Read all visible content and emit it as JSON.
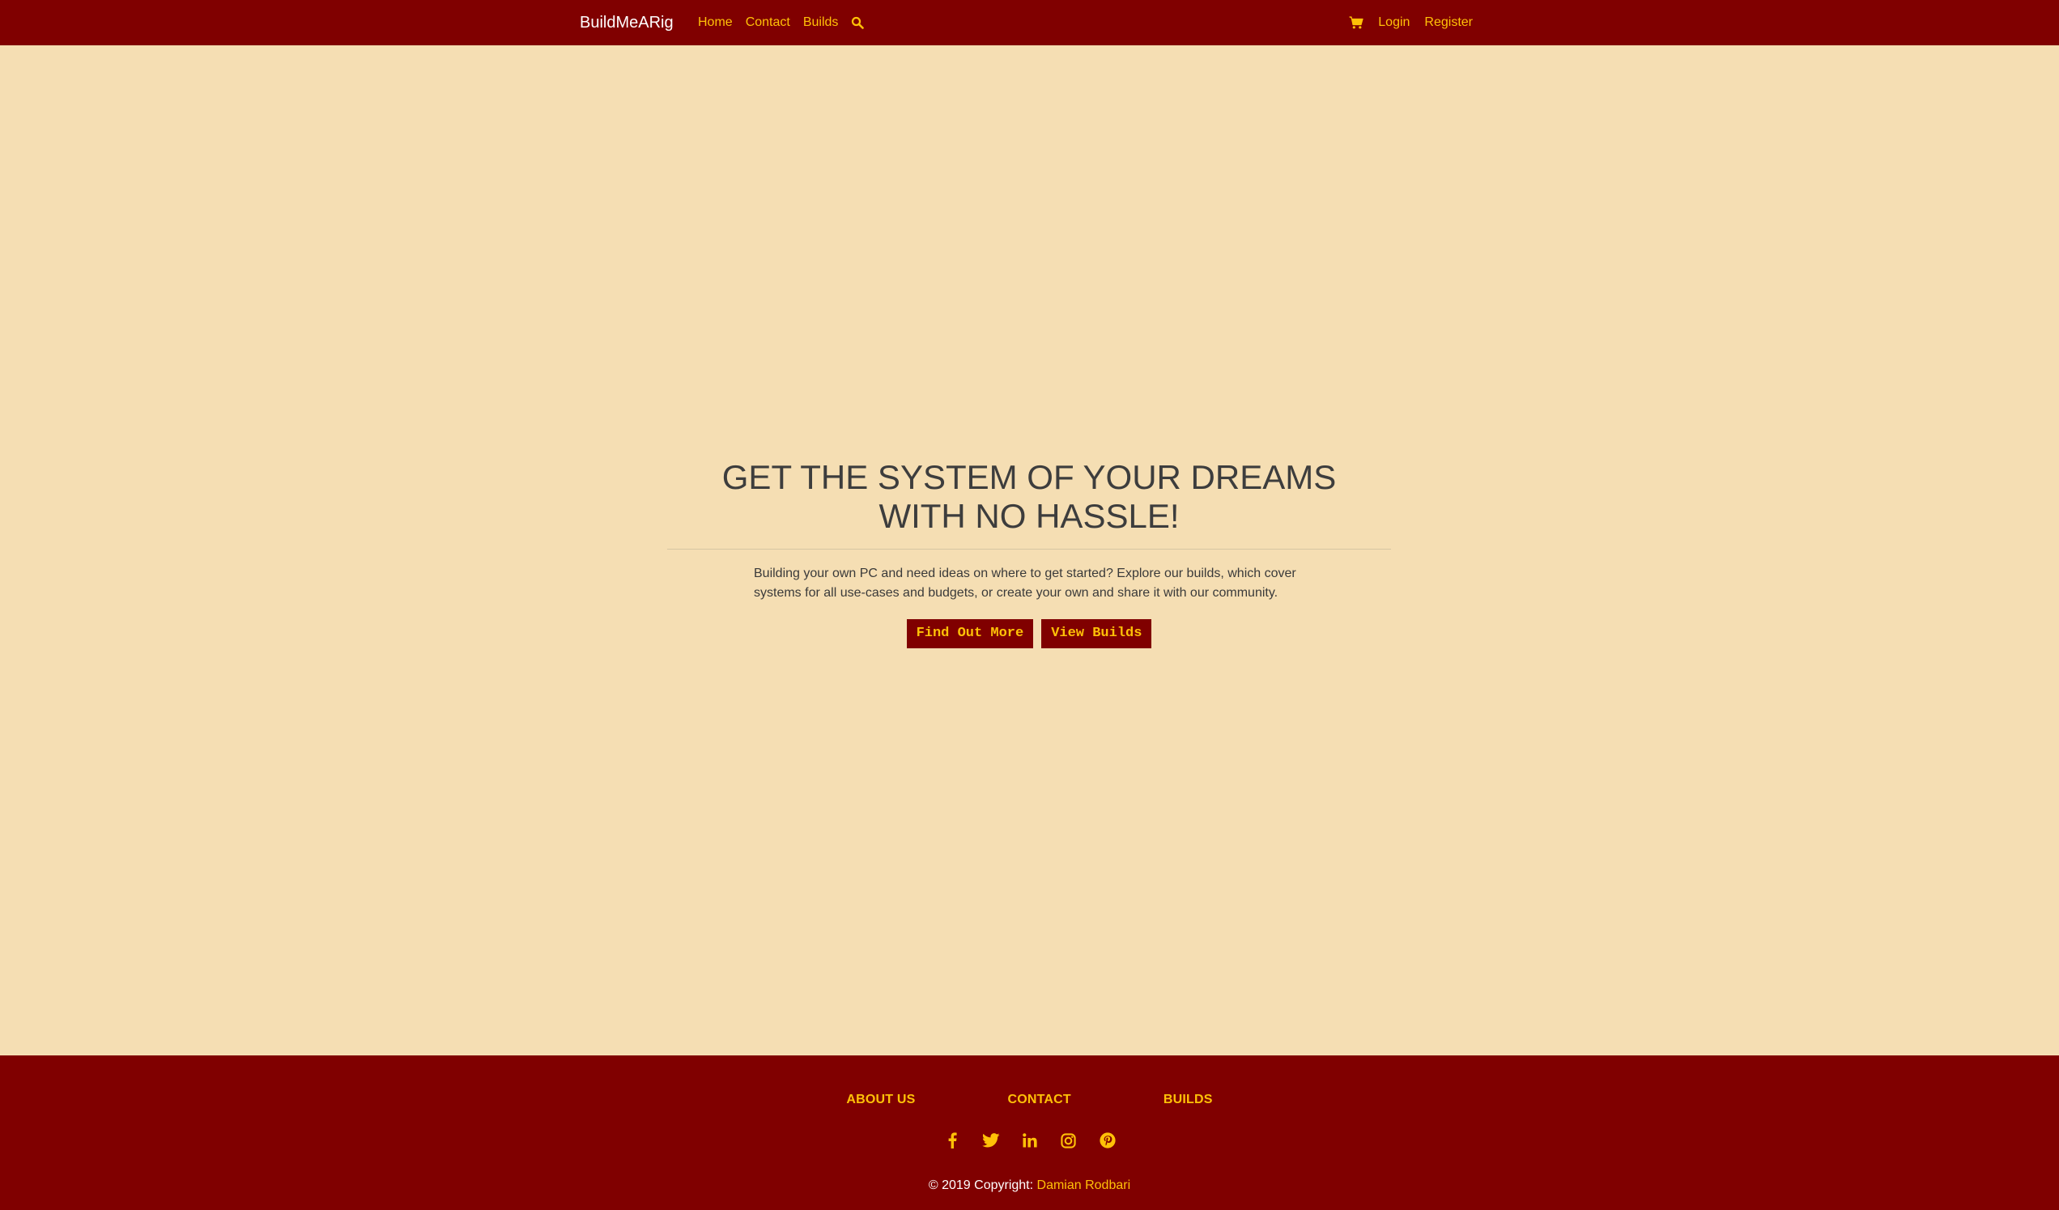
{
  "navbar": {
    "brand": "BuildMeARig",
    "links": [
      "Home",
      "Contact",
      "Builds"
    ],
    "search_icon": "search-icon",
    "cart_icon": "cart-icon",
    "login": "Login",
    "register": "Register"
  },
  "hero": {
    "title": "GET THE SYSTEM OF YOUR DREAMS WITH NO HASSLE!",
    "description": "Building your own PC and need ideas on where to get started? Explore our builds, which cover systems for all use-cases and budgets, or create your own and share it with our community.",
    "buttons": [
      "Find Out More",
      "View Builds"
    ]
  },
  "footer": {
    "links": [
      "ABOUT US",
      "CONTACT",
      "BUILDS"
    ],
    "social_icons": [
      "facebook-icon",
      "twitter-icon",
      "linkedin-icon",
      "instagram-icon",
      "pinterest-icon"
    ],
    "copyright_prefix": "© 2019 Copyright:",
    "copyright_author": "Damian Rodbari"
  },
  "colors": {
    "primary": "#800000",
    "accent": "#ffc107",
    "background": "#f5deb3",
    "text": "#3d3d3d"
  }
}
